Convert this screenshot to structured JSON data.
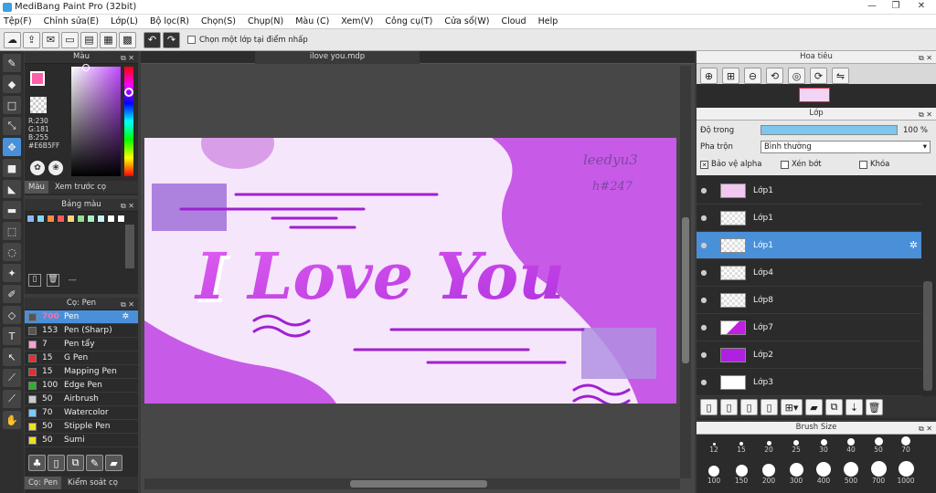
{
  "window": {
    "title": "MediBang Paint Pro (32bit)"
  },
  "menu": [
    "Tệp(F)",
    "Chỉnh sửa(E)",
    "Lớp(L)",
    "Bộ lọc(R)",
    "Chọn(S)",
    "Chụp(N)",
    "Màu (C)",
    "Xem(V)",
    "Công cụ(T)",
    "Cửa sổ(W)",
    "Cloud",
    "Help"
  ],
  "toolbar": {
    "checkbox_label": "Chọn một lớp tại điểm nhấp"
  },
  "color": {
    "title": "Màu",
    "r": "R:230",
    "g": "G:181",
    "b": "B:255",
    "hex": "#E6B5FF",
    "tab1": "Màu",
    "tab2": "Xem trước cọ",
    "main_color": "#e6b5ff"
  },
  "palette": {
    "title": "Bảng màu",
    "placeholder": "---",
    "swatches": [
      "#8fb3ff",
      "#7fd6ff",
      "#ff8a3c",
      "#ff5a5a",
      "#ffd27a",
      "#8fe08f",
      "#a8f0c0",
      "#c7f0ff",
      "#ffffff",
      "#ffffff"
    ]
  },
  "brush": {
    "title": "Cọ: Pen",
    "tab1": "Cọ: Pen",
    "tab2": "Kiểm soát cọ",
    "items": [
      {
        "size": "700",
        "name": "Pen",
        "color": "#555555"
      },
      {
        "size": "153",
        "name": "Pen (Sharp)",
        "color": "#555555"
      },
      {
        "size": "7",
        "name": "Pen tẩy",
        "color": "#ff9fd0"
      },
      {
        "size": "15",
        "name": "G Pen",
        "color": "#e03030"
      },
      {
        "size": "15",
        "name": "Mapping Pen",
        "color": "#e03030"
      },
      {
        "size": "100",
        "name": "Edge Pen",
        "color": "#30b030"
      },
      {
        "size": "50",
        "name": "Airbrush",
        "color": "#cccccc"
      },
      {
        "size": "70",
        "name": "Watercolor",
        "color": "#77ccff"
      },
      {
        "size": "50",
        "name": "Stipple Pen",
        "color": "#f0e020"
      },
      {
        "size": "50",
        "name": "Sumi",
        "color": "#f0e020"
      }
    ]
  },
  "document": {
    "tab": "ilove you.mdp",
    "main_text": "I Love You",
    "signature_line1": "leedyu3",
    "signature_line2": "h#247"
  },
  "navigator": {
    "title": "Hoa tiêu"
  },
  "layer": {
    "title": "Lớp",
    "opacity_label": "Độ trong",
    "opacity_value": "100 %",
    "opacity_fraction": 1.0,
    "blend_label": "Pha trộn",
    "blend_value": "Bình thường",
    "protect_alpha": "Bảo vệ alpha",
    "clip": "Xén bớt",
    "lock": "Khóa",
    "rows": [
      {
        "name": "Lớp1",
        "sel": false,
        "thumb": "pink"
      },
      {
        "name": "Lớp1",
        "sel": false,
        "thumb": "check"
      },
      {
        "name": "Lớp1",
        "sel": true,
        "thumb": "check"
      },
      {
        "name": "Lớp4",
        "sel": false,
        "thumb": "check"
      },
      {
        "name": "Lớp8",
        "sel": false,
        "thumb": "check"
      },
      {
        "name": "Lớp7",
        "sel": false,
        "thumb": "purple"
      },
      {
        "name": "Lớp2",
        "sel": false,
        "thumb": "solid"
      },
      {
        "name": "Lớp3",
        "sel": false,
        "thumb": "white"
      }
    ]
  },
  "brushsize": {
    "title": "Brush Size",
    "row1": [
      "12",
      "15",
      "20",
      "25",
      "30",
      "40",
      "50",
      "70"
    ],
    "row2": [
      "100",
      "150",
      "200",
      "300",
      "400",
      "500",
      "700",
      "1000"
    ]
  }
}
